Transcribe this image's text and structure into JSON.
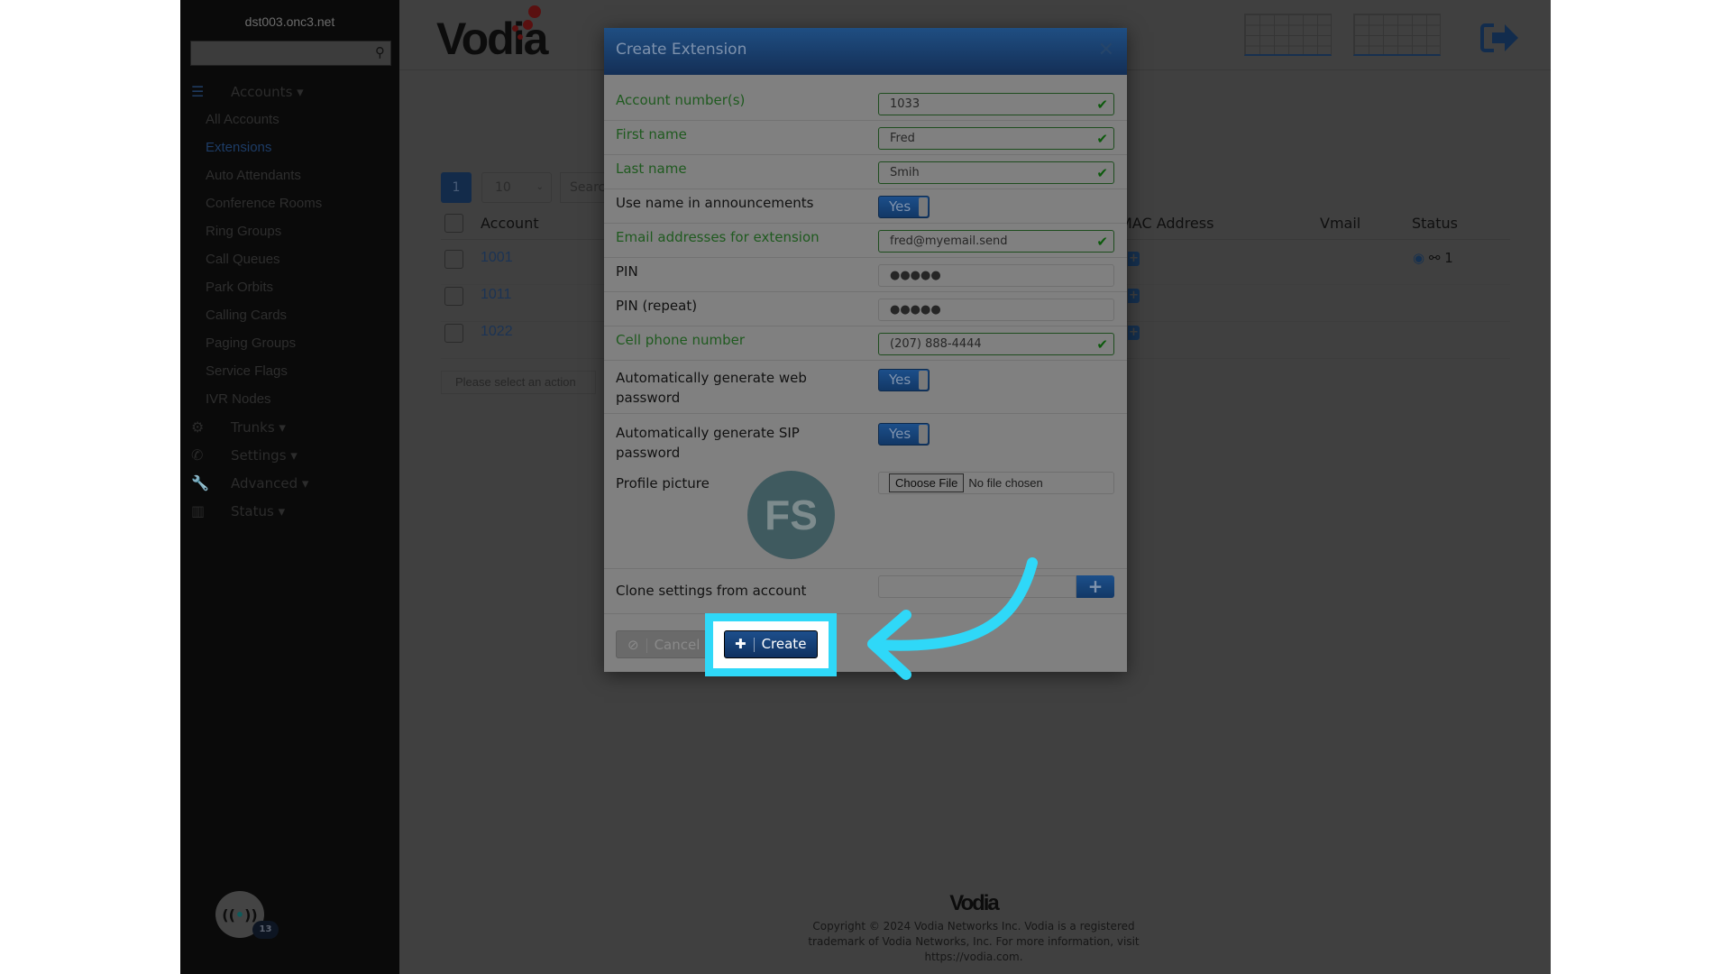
{
  "sidebar": {
    "host": "dst003.onc3.net",
    "search_icon": "search-icon",
    "accounts_label": "Accounts",
    "items": [
      "All Accounts",
      "Extensions",
      "Auto Attendants",
      "Conference Rooms",
      "Ring Groups",
      "Call Queues",
      "Park Orbits",
      "Calling Cards",
      "Paging Groups",
      "Service Flags",
      "IVR Nodes"
    ],
    "active": "Extensions",
    "sections": [
      {
        "label": "Trunks",
        "icon": "gears-icon"
      },
      {
        "label": "Settings",
        "icon": "phone-icon"
      },
      {
        "label": "Advanced",
        "icon": "wrench-icon"
      },
      {
        "label": "Status",
        "icon": "bar-chart-icon"
      }
    ],
    "badge_count": "13"
  },
  "header": {
    "logo": "Vodia",
    "logout_icon": "logout-icon"
  },
  "table": {
    "page": "1",
    "page_size": "10",
    "search_placeholder": "Search",
    "columns": {
      "account": "Account",
      "mac": "MAC Address",
      "vmail": "Vmail",
      "status": "Status"
    },
    "rows": [
      {
        "account": "1001",
        "status": "1"
      },
      {
        "account": "1011",
        "status": ""
      },
      {
        "account": "1022",
        "status": ""
      }
    ],
    "action_placeholder": "Please select an action"
  },
  "modal": {
    "title": "Create Extension",
    "account_label": "Account number(s)",
    "account_value": "1033",
    "first_label": "First name",
    "first_value": "Fred",
    "last_label": "Last name",
    "last_value": "Smih",
    "announce_label": "Use name in announcements",
    "announce_value": "Yes",
    "email_label": "Email addresses for extension",
    "email_value": "fred@myemail.send",
    "pin_label": "PIN",
    "pin_value": "●●●●●",
    "pin2_label": "PIN (repeat)",
    "pin2_value": "●●●●●",
    "cell_label": "Cell phone number",
    "cell_value": "(207) 888-4444",
    "web_label": "Automatically generate web password",
    "web_value": "Yes",
    "sip_label": "Automatically generate SIP password",
    "sip_value": "Yes",
    "picture_label": "Profile picture",
    "choose_file": "Choose File",
    "no_file": "No file chosen",
    "avatar_initials": "FS",
    "clone_label": "Clone settings from account",
    "cancel": "Cancel",
    "create": "Create"
  },
  "footer": {
    "logo": "Vodia",
    "line1": "Copyright © 2024 Vodia Networks Inc. Vodia is a registered",
    "line2": "trademark of Vodia Networks, Inc. For more information, visit",
    "line3": "https://vodia.com."
  },
  "colors": {
    "highlight": "#2fd8f8",
    "brand_blue": "#1d4f8c",
    "valid_green": "#1f5a1f",
    "logo_red": "#c0201f"
  }
}
